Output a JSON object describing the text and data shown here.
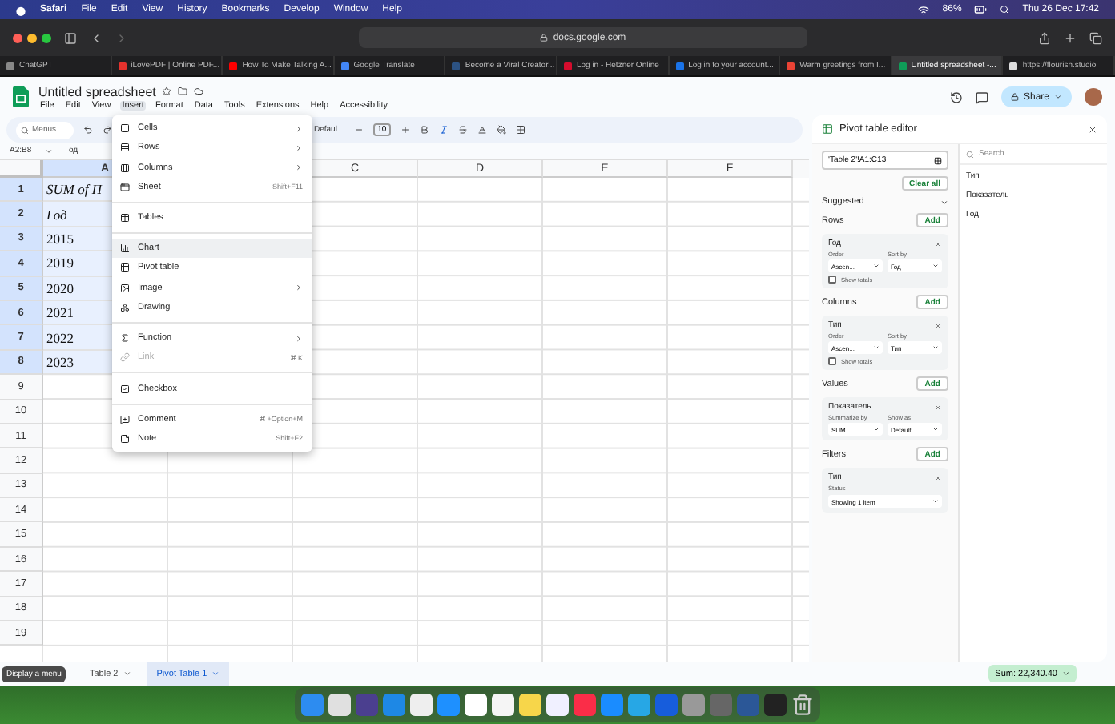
{
  "mac_menu_bar": {
    "items": [
      {
        "label": "Safari",
        "kind": "app"
      },
      {
        "label": "File",
        "kind": "menu"
      },
      {
        "label": "Edit",
        "kind": "menu"
      },
      {
        "label": "View",
        "kind": "menu"
      },
      {
        "label": "History",
        "kind": "menu"
      },
      {
        "label": "Bookmarks",
        "kind": "menu"
      },
      {
        "label": "Develop",
        "kind": "menu"
      },
      {
        "label": "Window",
        "kind": "menu"
      },
      {
        "label": "Help",
        "kind": "menu"
      }
    ],
    "battery": "86%",
    "clock": "Thu 26 Dec  17:42"
  },
  "browser": {
    "address": "docs.google.com",
    "tabs": [
      {
        "title": "ChatGPT",
        "selected": false
      },
      {
        "title": "iLovePDF | Online PDF...",
        "selected": false
      },
      {
        "title": "How To Make Talking A...",
        "selected": false
      },
      {
        "title": "Google Translate",
        "selected": false
      },
      {
        "title": "Become a Viral Creator...",
        "selected": false
      },
      {
        "title": "Log in - Hetzner Online",
        "selected": false
      },
      {
        "title": "Log in to your account...",
        "selected": false
      },
      {
        "title": "Warm greetings from I...",
        "selected": false
      },
      {
        "title": "Untitled spreadsheet -...",
        "selected": true
      },
      {
        "title": "https://flourish.studio",
        "selected": false
      }
    ]
  },
  "doc": {
    "title": "Untitled spreadsheet",
    "share": "Share",
    "menus": [
      {
        "label": "File",
        "selected": false
      },
      {
        "label": "Edit",
        "selected": false
      },
      {
        "label": "View",
        "selected": false
      },
      {
        "label": "Insert",
        "selected": true
      },
      {
        "label": "Format",
        "selected": false
      },
      {
        "label": "Data",
        "selected": false
      },
      {
        "label": "Tools",
        "selected": false
      },
      {
        "label": "Extensions",
        "selected": false
      },
      {
        "label": "Help",
        "selected": false
      },
      {
        "label": "Accessibility",
        "selected": false
      }
    ]
  },
  "toolbar": {
    "search_placeholder": "Menus",
    "font": "Defaul...",
    "font_size": "10"
  },
  "formula_bar": {
    "range": "A2:B8",
    "content": "Год"
  },
  "grid": {
    "columns": [
      {
        "label": "A",
        "selected": true
      },
      {
        "label": "C",
        "selected": false
      },
      {
        "label": "D",
        "selected": false
      },
      {
        "label": "E",
        "selected": false
      },
      {
        "label": "F",
        "selected": false
      }
    ],
    "rows": [
      {
        "number": "1",
        "selected": true,
        "cell": "SUM of П",
        "italic": true
      },
      {
        "number": "2",
        "selected": true,
        "cell": "Год",
        "italic": true
      },
      {
        "number": "3",
        "selected": true,
        "cell": "2015",
        "italic": false
      },
      {
        "number": "4",
        "selected": true,
        "cell": "2019",
        "italic": false
      },
      {
        "number": "5",
        "selected": true,
        "cell": "2020",
        "italic": false
      },
      {
        "number": "6",
        "selected": true,
        "cell": "2021",
        "italic": false
      },
      {
        "number": "7",
        "selected": true,
        "cell": "2022",
        "italic": false
      },
      {
        "number": "8",
        "selected": true,
        "cell": "2023",
        "italic": false
      },
      {
        "number": "9",
        "selected": false
      },
      {
        "number": "10",
        "selected": false
      },
      {
        "number": "11",
        "selected": false
      },
      {
        "number": "12",
        "selected": false
      },
      {
        "number": "13",
        "selected": false
      },
      {
        "number": "14",
        "selected": false
      },
      {
        "number": "15",
        "selected": false
      },
      {
        "number": "16",
        "selected": false
      },
      {
        "number": "17",
        "selected": false
      },
      {
        "number": "18",
        "selected": false
      },
      {
        "number": "19",
        "selected": false
      }
    ]
  },
  "insert_menu": {
    "items": [
      {
        "kind": "item",
        "label": "Cells",
        "submenu": true,
        "highlighted": false,
        "disabled": false
      },
      {
        "kind": "item",
        "label": "Rows",
        "submenu": true,
        "highlighted": false,
        "disabled": false
      },
      {
        "kind": "item",
        "label": "Columns",
        "submenu": true,
        "highlighted": false,
        "disabled": false
      },
      {
        "kind": "item",
        "label": "Sheet",
        "shortcut": "Shift+F11",
        "submenu": false,
        "highlighted": false,
        "disabled": false
      },
      {
        "kind": "divider"
      },
      {
        "kind": "item",
        "label": "Tables",
        "submenu": false,
        "highlighted": false,
        "disabled": false
      },
      {
        "kind": "divider"
      },
      {
        "kind": "item",
        "label": "Chart",
        "submenu": false,
        "highlighted": true,
        "disabled": false
      },
      {
        "kind": "item",
        "label": "Pivot table",
        "submenu": false,
        "highlighted": false,
        "disabled": false
      },
      {
        "kind": "item",
        "label": "Image",
        "submenu": true,
        "highlighted": false,
        "disabled": false
      },
      {
        "kind": "item",
        "label": "Drawing",
        "submenu": false,
        "highlighted": false,
        "disabled": false
      },
      {
        "kind": "divider"
      },
      {
        "kind": "item",
        "label": "Function",
        "submenu": true,
        "highlighted": false,
        "disabled": false
      },
      {
        "kind": "item",
        "label": "Link",
        "shortcut": "⌘K",
        "submenu": false,
        "highlighted": false,
        "disabled": true
      },
      {
        "kind": "divider"
      },
      {
        "kind": "item",
        "label": "Checkbox",
        "submenu": false,
        "highlighted": false,
        "disabled": false
      },
      {
        "kind": "divider"
      },
      {
        "kind": "item",
        "label": "Comment",
        "shortcut": "⌘+Option+M",
        "submenu": false,
        "highlighted": false,
        "disabled": false
      },
      {
        "kind": "item",
        "label": "Note",
        "shortcut": "Shift+F2",
        "submenu": false,
        "highlighted": false,
        "disabled": false
      }
    ]
  },
  "pivot_editor": {
    "title": "Pivot table editor",
    "range": "'Table 2'!A1:C13",
    "clear_all": "Clear all",
    "suggested": "Suggested",
    "sections": [
      {
        "title": "Rows",
        "add": "Add",
        "card": {
          "kind": "order",
          "field": "Год",
          "labels": [
            "Order",
            "Sort by"
          ],
          "selects": [
            "Ascen...",
            "Год"
          ],
          "show_totals": "Show totals",
          "checked": false
        }
      },
      {
        "title": "Columns",
        "add": "Add",
        "card": {
          "kind": "order",
          "field": "Тип",
          "labels": [
            "Order",
            "Sort by"
          ],
          "selects": [
            "Ascen...",
            "Тип"
          ],
          "show_totals": "Show totals",
          "checked": false
        }
      },
      {
        "title": "Values",
        "add": "Add",
        "card": {
          "kind": "value",
          "field": "Показатель",
          "labels": [
            "Summarize by",
            "Show as"
          ],
          "selects": [
            "SUM",
            "Default"
          ]
        }
      },
      {
        "title": "Filters",
        "add": "Add",
        "card": {
          "kind": "filter",
          "field": "Тип",
          "labels": [
            "Status"
          ],
          "selects": [
            "Showing 1 item"
          ]
        }
      }
    ],
    "field_search_placeholder": "Search",
    "fields": [
      "Тип",
      "Показатель",
      "Год"
    ]
  },
  "sheets": {
    "tabs": [
      {
        "label": "Table 2",
        "selected": false
      },
      {
        "label": "Pivot Table 1",
        "selected": true
      }
    ],
    "sum": "Sum: 22,340.40",
    "tooltip": "Display a menu"
  }
}
